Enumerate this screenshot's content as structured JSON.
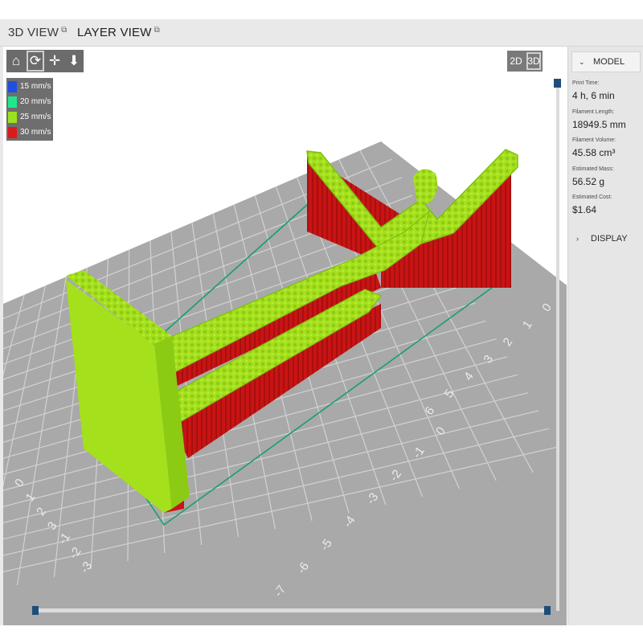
{
  "tabs": [
    {
      "label": "3D VIEW",
      "active": false
    },
    {
      "label": "LAYER VIEW",
      "active": true
    }
  ],
  "toolbar": [
    {
      "name": "home",
      "icon": "home-icon",
      "glyph": "🏠"
    },
    {
      "name": "rotate",
      "icon": "rotate-icon",
      "glyph": "⟳"
    },
    {
      "name": "pan",
      "icon": "pan-icon",
      "glyph": "✛"
    },
    {
      "name": "zoom",
      "icon": "zoom-icon",
      "glyph": "⬇"
    }
  ],
  "view_toggle": {
    "mode_2d": "2D",
    "mode_3d": "3D",
    "selected": "3D"
  },
  "legend": [
    {
      "label": "15 mm/s",
      "color": "#1e4fe0"
    },
    {
      "label": "20 mm/s",
      "color": "#1ee88a"
    },
    {
      "label": "25 mm/s",
      "color": "#9be21e"
    },
    {
      "label": "30 mm/s",
      "color": "#dd1a1a"
    }
  ],
  "sidebar": {
    "model_label": "MODEL",
    "display_label": "DISPLAY",
    "stats": [
      {
        "label": "Print Time:",
        "value": "4 h, 6 min"
      },
      {
        "label": "Filament Length:",
        "value": "18949.5 mm"
      },
      {
        "label": "Filament Volume:",
        "value": "45.58 cm³"
      },
      {
        "label": "Estimated Mass:",
        "value": "56.52 g"
      },
      {
        "label": "Estimated Cost:",
        "value": "$1.64"
      }
    ]
  },
  "bed_axis_labels": [
    "0",
    "1",
    "2",
    "3",
    "4",
    "5",
    "6",
    "0",
    "-1",
    "-2",
    "-3",
    "-4",
    "-5",
    "-6",
    "-7",
    "0",
    "1",
    "2",
    "3",
    "-1",
    "-2",
    "-3"
  ],
  "colors": {
    "bed": "#a9a9a9",
    "grid": "#d2d2d2",
    "model_fill": "#a4e01c",
    "model_support": "#d01616",
    "bounding_box": "#1aa06a",
    "sidebar_bg": "#e6e6e6"
  }
}
